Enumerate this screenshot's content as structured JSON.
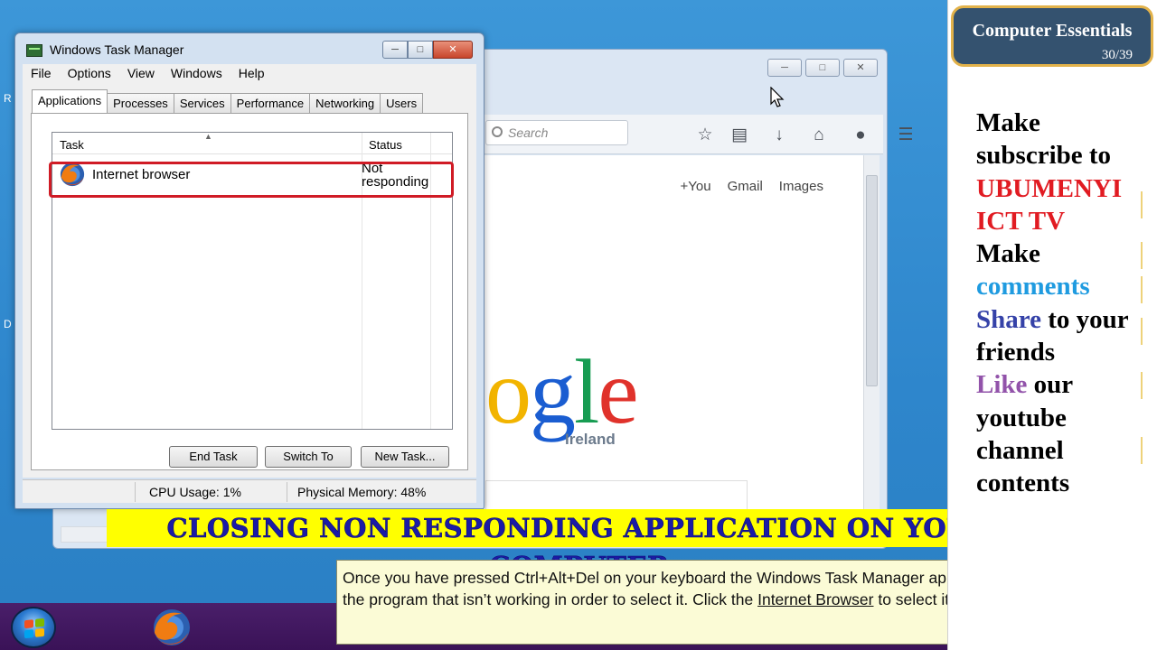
{
  "task_manager": {
    "title": "Windows Task Manager",
    "menu": [
      "File",
      "Options",
      "View",
      "Windows",
      "Help"
    ],
    "tabs": [
      "Applications",
      "Processes",
      "Services",
      "Performance",
      "Networking",
      "Users"
    ],
    "active_tab": "Applications",
    "columns": {
      "task": "Task",
      "status": "Status"
    },
    "rows": [
      {
        "task": "Internet browser",
        "status": "Not responding",
        "icon": "firefox-icon"
      }
    ],
    "buttons": {
      "end_task": "End Task",
      "switch_to": "Switch To",
      "new_task": "New Task..."
    },
    "status_bar": {
      "cpu": "CPU Usage: 1%",
      "memory": "Physical Memory: 48%"
    }
  },
  "browser": {
    "search_placeholder": "Search",
    "links": [
      "+You",
      "Gmail",
      "Images"
    ],
    "logo_visible": "ogle",
    "logo_region": "Ireland"
  },
  "headline": "CLOSING NON RESPONDING APPLICATION ON YOUR COMPUTER",
  "instruction": {
    "before": "Once you have pressed Ctrl+Alt+Del on your keyboard the Windows Task Manager appears. You need to select the program that isn’t working in order to select it. Click the ",
    "link": "Internet Browser",
    "after": " to select it."
  },
  "badge": {
    "title": "Computer Essentials",
    "counter": "30/39"
  },
  "promo": {
    "line1": "Make subscribe to",
    "channel": "UBUMENYI ICT TV",
    "make": "Make",
    "comments": "comments",
    "share": "Share",
    "share_rest": "to your friends",
    "like": "Like",
    "like_rest": "our youtube channel contents"
  },
  "colors": {
    "highlight_red": "#d01b25",
    "headline_bg": "#ffff00",
    "headline_text": "#1b1ba6",
    "taskbar": "#3a1257",
    "badge_bg": "#34526f"
  }
}
